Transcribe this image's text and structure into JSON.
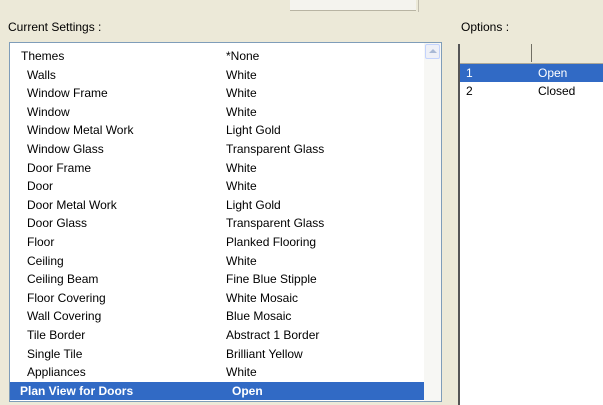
{
  "current_settings_label": "Current Settings :",
  "options_label": "Options :",
  "settings": [
    {
      "name": "Themes",
      "value": "*None"
    },
    {
      "name": "Walls",
      "value": "White"
    },
    {
      "name": "Window Frame",
      "value": "White"
    },
    {
      "name": "Window",
      "value": "White"
    },
    {
      "name": "Window Metal Work",
      "value": "Light Gold"
    },
    {
      "name": "Window Glass",
      "value": "Transparent Glass"
    },
    {
      "name": "Door Frame",
      "value": "White"
    },
    {
      "name": "Door",
      "value": "White"
    },
    {
      "name": "Door Metal Work",
      "value": "Light Gold"
    },
    {
      "name": "Door Glass",
      "value": "Transparent Glass"
    },
    {
      "name": "Floor",
      "value": "Planked Flooring"
    },
    {
      "name": "Ceiling",
      "value": "White"
    },
    {
      "name": "Ceiling Beam",
      "value": "Fine Blue Stipple"
    },
    {
      "name": "Floor Covering",
      "value": "White Mosaic"
    },
    {
      "name": "Wall Covering",
      "value": "Blue Mosaic"
    },
    {
      "name": "Tile Border",
      "value": "Abstract 1 Border"
    },
    {
      "name": "Single Tile",
      "value": "Brilliant Yellow"
    },
    {
      "name": "Appliances",
      "value": "White"
    },
    {
      "name": "Plan View for Doors",
      "value": "Open"
    }
  ],
  "options": [
    {
      "number": "1",
      "label": "Open"
    },
    {
      "number": "2",
      "label": "Closed"
    }
  ],
  "colors": {
    "selection": "#316ac5",
    "background": "#ece9d8",
    "list_border": "#7f9db9"
  }
}
